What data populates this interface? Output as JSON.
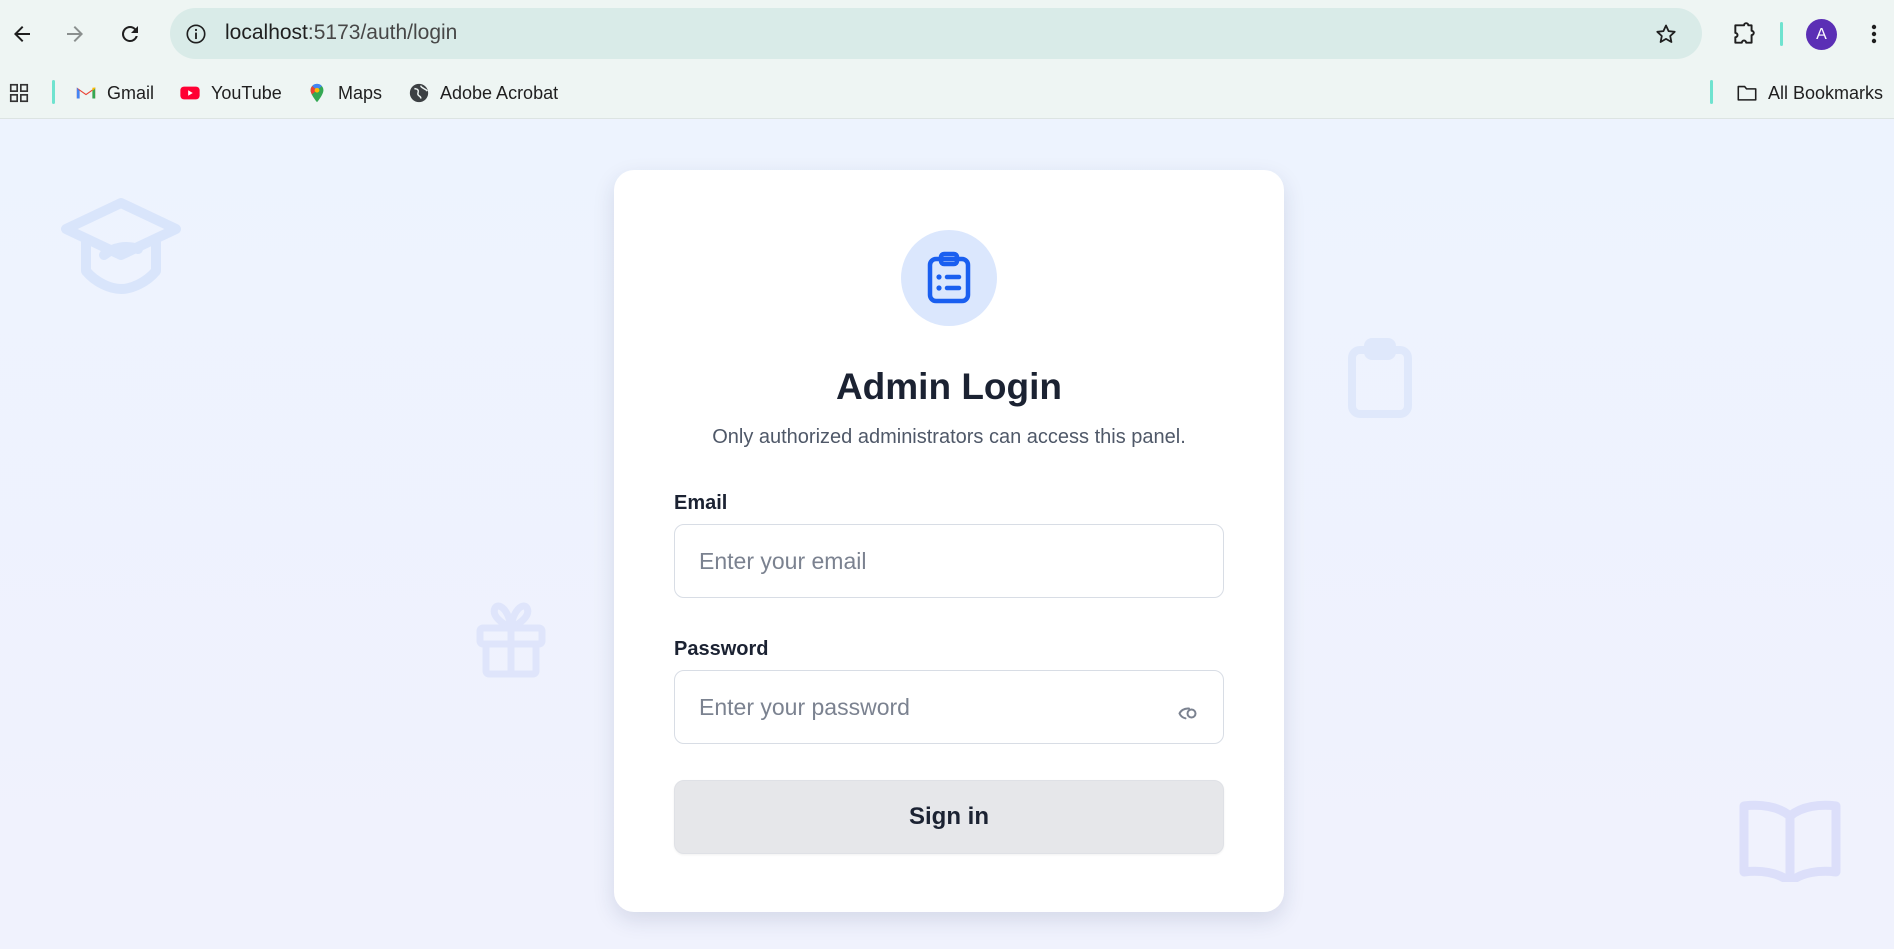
{
  "browser": {
    "url_host": "localhost",
    "url_path": ":5173/auth/login",
    "avatar_letter": "A",
    "bookmarks": [
      {
        "label": "Gmail",
        "icon": "gmail-icon"
      },
      {
        "label": "YouTube",
        "icon": "youtube-icon"
      },
      {
        "label": "Maps",
        "icon": "maps-icon"
      },
      {
        "label": "Adobe Acrobat",
        "icon": "globe-icon"
      }
    ],
    "all_bookmarks_label": "All Bookmarks"
  },
  "login": {
    "title": "Admin Login",
    "subtitle": "Only authorized administrators can access this panel.",
    "email_label": "Email",
    "email_placeholder": "Enter your email",
    "email_value": "",
    "password_label": "Password",
    "password_placeholder": "Enter your password",
    "password_value": "",
    "submit_label": "Sign in"
  },
  "colors": {
    "brand_blue": "#1a5ff0",
    "logo_bg": "#dbe7fd",
    "page_bg": "#eef3fd",
    "button_bg": "#e6e7ea",
    "avatar_bg": "#5b2fb5"
  }
}
